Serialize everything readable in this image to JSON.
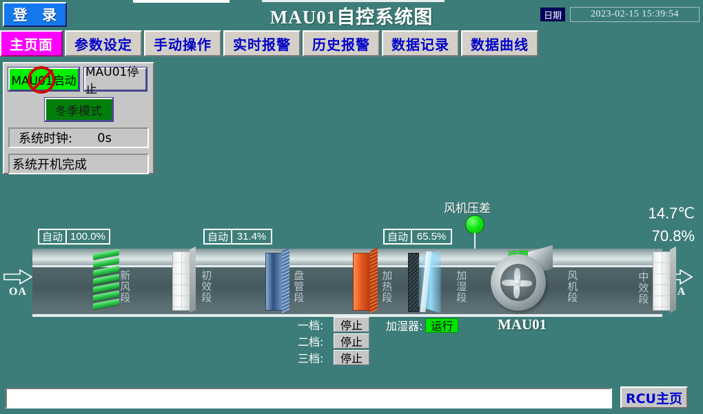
{
  "header": {
    "login_label": "登  录",
    "title": "MAU01自控系统图",
    "date_label": "日期",
    "datetime": "2023-02-15 15:39:54"
  },
  "tabs": [
    {
      "label": "主页面",
      "active": true
    },
    {
      "label": "参数设定",
      "active": false
    },
    {
      "label": "手动操作",
      "active": false
    },
    {
      "label": "实时报警",
      "active": false
    },
    {
      "label": "历史报警",
      "active": false
    },
    {
      "label": "数据记录",
      "active": false
    },
    {
      "label": "数据曲线",
      "active": false
    }
  ],
  "control_panel": {
    "start_button": "MAU01启动",
    "stop_button": "MAU01停止",
    "mode_button": "冬季模式",
    "clock_label": "系统时钟:",
    "clock_value": "0s",
    "status_text": "系统开机完成"
  },
  "ahu": {
    "inlet_label": "OA",
    "outlet_label": "SA",
    "unit_name": "MAU01",
    "fan_mode_label": "远程",
    "sections": [
      {
        "name": "新风段"
      },
      {
        "name": "初效段"
      },
      {
        "name": "盘管段"
      },
      {
        "name": "加热段"
      },
      {
        "name": "加湿段"
      },
      {
        "name": "风机段"
      },
      {
        "name": "中效段"
      }
    ],
    "auto_boxes": [
      {
        "mode": "自动",
        "value": "100.0%"
      },
      {
        "mode": "自动",
        "value": "31.4%"
      },
      {
        "mode": "自动",
        "value": "65.5%"
      }
    ],
    "pressure": {
      "label": "风机压差",
      "lamp_color": "#10e810"
    },
    "readouts": {
      "temperature": "14.7℃",
      "humidity": "70.8%"
    },
    "stages": [
      {
        "key": "一档:",
        "value": "停止"
      },
      {
        "key": "二档:",
        "value": "停止"
      },
      {
        "key": "三档:",
        "value": "停止"
      }
    ],
    "humidifier": {
      "key": "加湿器:",
      "value": "运行",
      "color": "#00e400"
    }
  },
  "footer": {
    "alarm_text": "",
    "rcu_button": "RCU主页"
  },
  "colors": {
    "background": "#3d7d79",
    "accent_active_tab": "#ff00ff",
    "tab_text": "#0000c8",
    "login_bg": "#1478ef",
    "running_green": "#00e400"
  }
}
